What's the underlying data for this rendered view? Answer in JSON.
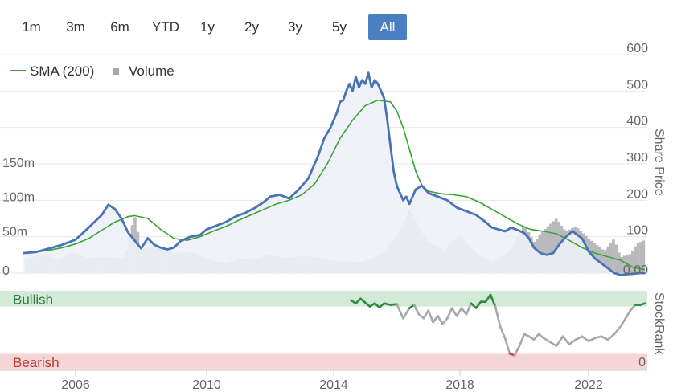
{
  "range_selector": {
    "buttons": [
      "1m",
      "3m",
      "6m",
      "YTD",
      "1y",
      "2y",
      "3y",
      "5y",
      "All"
    ],
    "active": "All"
  },
  "legend": {
    "items": [
      {
        "label": "SMA (200)",
        "color": "#3aa335",
        "symbol": "line"
      },
      {
        "label": "Volume",
        "color": "#a9a9a9",
        "symbol": "square"
      }
    ]
  },
  "colors": {
    "price": "#4a73b5",
    "price_fill": "#eef1f8",
    "sma": "#3aa335",
    "volume": "#b9b9bd",
    "bullish_band": "#d3ead9",
    "bearish_band": "#f5d5d7",
    "rank_neutral": "#a8a8a8",
    "rank_bullish": "#2f8a3a",
    "rank_bearish": "#d04545",
    "bullish_text": "#2f7d3a",
    "bearish_text": "#c0392b"
  },
  "chart_data": [
    {
      "type": "line",
      "ylabel": "Share Price",
      "ylim": [
        0,
        600
      ],
      "yticks": [
        "0.00",
        "100",
        "200",
        "300",
        "400",
        "500",
        "600"
      ],
      "x_ticks": [
        "2006",
        "2010",
        "2014",
        "2018",
        "2022"
      ],
      "x_tick_years": [
        2006,
        2010,
        2014,
        2018,
        2022
      ],
      "xlim": [
        2004.4,
        2023.75
      ],
      "series": [
        {
          "name": "Share Price",
          "x": [
            2004.4,
            2004.8,
            2005.2,
            2005.6,
            2006.0,
            2006.4,
            2006.8,
            2007.0,
            2007.2,
            2007.4,
            2007.6,
            2007.8,
            2008.0,
            2008.2,
            2008.4,
            2008.6,
            2008.8,
            2009.0,
            2009.2,
            2009.5,
            2009.8,
            2010.0,
            2010.3,
            2010.6,
            2010.9,
            2011.2,
            2011.5,
            2011.8,
            2012.0,
            2012.3,
            2012.6,
            2012.9,
            2013.2,
            2013.5,
            2013.7,
            2013.9,
            2014.0,
            2014.1,
            2014.2,
            2014.3,
            2014.4,
            2014.5,
            2014.6,
            2014.7,
            2014.8,
            2014.9,
            2015.0,
            2015.1,
            2015.2,
            2015.3,
            2015.4,
            2015.5,
            2015.6,
            2015.7,
            2015.8,
            2015.9,
            2016.0,
            2016.1,
            2016.2,
            2016.3,
            2016.4,
            2016.6,
            2016.8,
            2017.0,
            2017.3,
            2017.6,
            2017.9,
            2018.2,
            2018.5,
            2018.8,
            2019.0,
            2019.2,
            2019.4,
            2019.6,
            2019.8,
            2020.0,
            2020.15,
            2020.3,
            2020.5,
            2020.7,
            2020.9,
            2021.1,
            2021.3,
            2021.5,
            2021.8,
            2022.0,
            2022.2,
            2022.5,
            2022.8,
            2023.0,
            2023.2,
            2023.4,
            2023.6,
            2023.75
          ],
          "y": [
            55,
            58,
            68,
            78,
            92,
            125,
            160,
            188,
            176,
            150,
            112,
            90,
            68,
            96,
            78,
            70,
            65,
            70,
            88,
            100,
            105,
            120,
            130,
            140,
            155,
            165,
            178,
            195,
            210,
            215,
            205,
            230,
            260,
            320,
            370,
            400,
            420,
            440,
            470,
            475,
            500,
            520,
            500,
            540,
            510,
            530,
            520,
            550,
            510,
            530,
            520,
            500,
            480,
            420,
            350,
            280,
            240,
            220,
            200,
            210,
            190,
            230,
            240,
            220,
            210,
            200,
            180,
            170,
            160,
            140,
            125,
            120,
            115,
            125,
            118,
            110,
            95,
            70,
            55,
            50,
            55,
            80,
            100,
            115,
            95,
            60,
            40,
            20,
            0,
            -5,
            -3,
            -2,
            0,
            0
          ]
        },
        {
          "name": "SMA (200)",
          "x": [
            2004.4,
            2004.8,
            2005.2,
            2005.6,
            2006.0,
            2006.4,
            2006.8,
            2007.2,
            2007.6,
            2007.8,
            2008.2,
            2008.6,
            2009.0,
            2009.4,
            2009.8,
            2010.2,
            2010.6,
            2011.0,
            2011.4,
            2011.8,
            2012.2,
            2012.6,
            2013.0,
            2013.4,
            2013.8,
            2014.2,
            2014.6,
            2015.0,
            2015.4,
            2015.8,
            2016.0,
            2016.2,
            2016.4,
            2016.6,
            2016.8,
            2017.0,
            2017.4,
            2017.8,
            2018.2,
            2018.6,
            2019.0,
            2019.4,
            2019.8,
            2020.2,
            2020.6,
            2021.0,
            2021.4,
            2021.8,
            2022.2,
            2022.6,
            2023.0,
            2023.4,
            2023.75
          ],
          "y": [
            55,
            58,
            63,
            70,
            80,
            95,
            118,
            140,
            155,
            158,
            150,
            120,
            95,
            90,
            100,
            115,
            128,
            145,
            160,
            175,
            190,
            200,
            215,
            245,
            300,
            370,
            420,
            460,
            475,
            470,
            445,
            400,
            340,
            280,
            240,
            225,
            218,
            215,
            210,
            195,
            175,
            155,
            135,
            120,
            115,
            108,
            90,
            70,
            55,
            45,
            35,
            15,
            10
          ]
        },
        {
          "name": "Volume",
          "unit": "shares",
          "ylim": [
            0,
            150000000
          ],
          "yticks": [
            "0",
            "50m",
            "100m",
            "150m"
          ],
          "x": [
            2004.5,
            2005.0,
            2005.5,
            2006.0,
            2006.5,
            2007.0,
            2007.5,
            2007.8,
            2008.0,
            2008.5,
            2009.0,
            2009.5,
            2010.0,
            2010.5,
            2011.0,
            2011.5,
            2012.0,
            2012.5,
            2013.0,
            2013.5,
            2014.0,
            2014.5,
            2015.0,
            2015.5,
            2016.0,
            2016.4,
            2016.8,
            2017.0,
            2017.5,
            2018.0,
            2018.5,
            2019.0,
            2019.5,
            2020.0,
            2020.3,
            2020.6,
            2021.0,
            2021.3,
            2021.6,
            2022.0,
            2022.5,
            2022.8,
            2023.0,
            2023.3,
            2023.5
          ],
          "y": [
            20000000,
            30000000,
            25000000,
            45000000,
            38000000,
            30000000,
            25000000,
            90000000,
            35000000,
            40000000,
            30000000,
            35000000,
            30000000,
            25000000,
            30000000,
            25000000,
            28000000,
            22000000,
            25000000,
            25000000,
            22000000,
            25000000,
            30000000,
            35000000,
            60000000,
            95000000,
            60000000,
            45000000,
            35000000,
            65000000,
            40000000,
            30000000,
            45000000,
            85000000,
            50000000,
            65000000,
            80000000,
            60000000,
            70000000,
            55000000,
            40000000,
            70000000,
            35000000,
            50000000,
            70000000
          ]
        }
      ]
    },
    {
      "type": "line",
      "ylabel": "StockRank",
      "yticks": [
        "0"
      ],
      "ylim": [
        0,
        100
      ],
      "bands": [
        {
          "label": "Bullish",
          "range": [
            80,
            100
          ]
        },
        {
          "label": "Bearish",
          "range": [
            0,
            20
          ]
        }
      ],
      "series": [
        {
          "name": "StockRank",
          "x": [
            2014.55,
            2014.7,
            2014.85,
            2015.0,
            2015.15,
            2015.3,
            2015.45,
            2015.6,
            2015.8,
            2016.0,
            2016.2,
            2016.4,
            2016.55,
            2016.7,
            2016.85,
            2017.0,
            2017.15,
            2017.3,
            2017.45,
            2017.6,
            2017.75,
            2017.9,
            2018.05,
            2018.2,
            2018.35,
            2018.5,
            2018.65,
            2018.8,
            2018.95,
            2019.1,
            2019.25,
            2019.4,
            2019.55,
            2019.7,
            2019.85,
            2020.0,
            2020.15,
            2020.3,
            2020.45,
            2020.6,
            2020.8,
            2021.0,
            2021.2,
            2021.4,
            2021.6,
            2021.8,
            2022.0,
            2022.2,
            2022.4,
            2022.6,
            2022.8,
            2023.0,
            2023.15,
            2023.3,
            2023.45,
            2023.6,
            2023.75
          ],
          "y": [
            88,
            84,
            90,
            85,
            80,
            84,
            79,
            84,
            82,
            83,
            65,
            78,
            82,
            70,
            65,
            75,
            60,
            68,
            58,
            65,
            78,
            68,
            78,
            70,
            84,
            78,
            86,
            86,
            95,
            80,
            55,
            40,
            20,
            18,
            30,
            45,
            42,
            38,
            45,
            40,
            35,
            30,
            42,
            32,
            38,
            42,
            36,
            40,
            42,
            38,
            45,
            55,
            65,
            75,
            82,
            82,
            84
          ]
        }
      ]
    }
  ]
}
